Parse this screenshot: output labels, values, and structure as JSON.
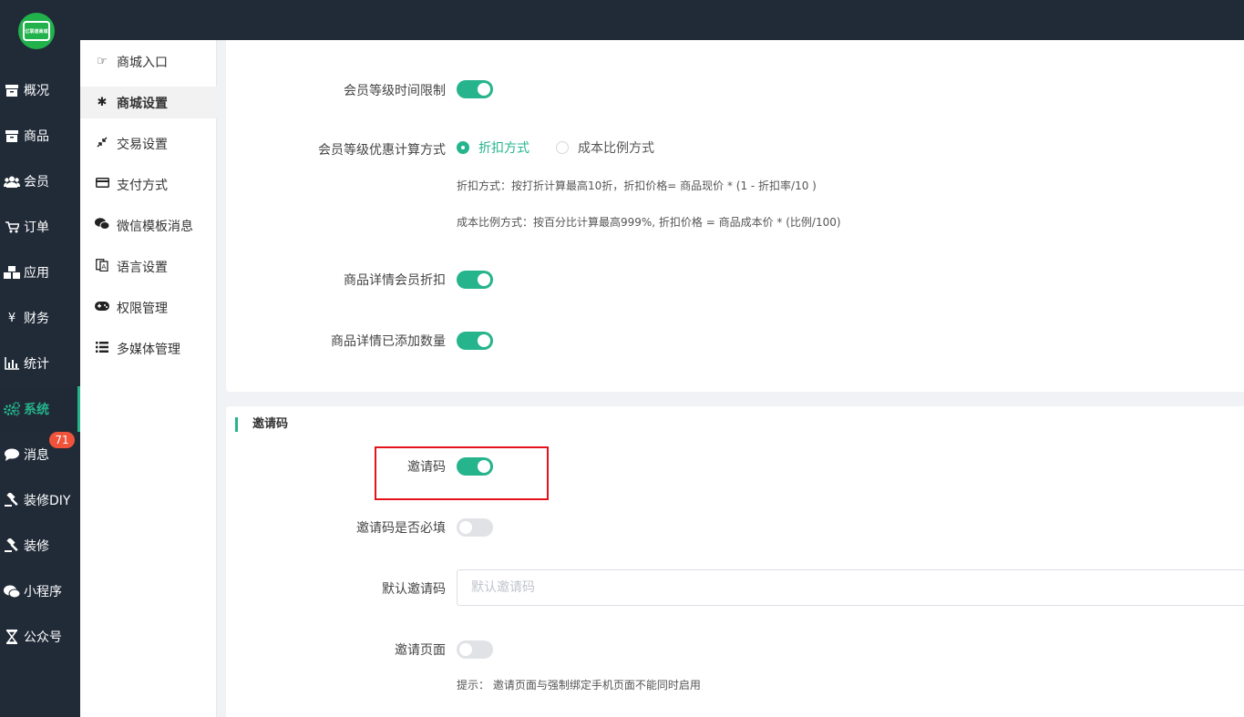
{
  "logo": {
    "text": "亿联道商城"
  },
  "nav": {
    "items": [
      {
        "label": "概况",
        "icon": "archive-icon"
      },
      {
        "label": "商品",
        "icon": "archive-icon"
      },
      {
        "label": "会员",
        "icon": "users-icon"
      },
      {
        "label": "订单",
        "icon": "cart-icon"
      },
      {
        "label": "应用",
        "icon": "cubes-icon"
      },
      {
        "label": "财务",
        "icon": "yen-icon"
      },
      {
        "label": "统计",
        "icon": "bar-chart-icon"
      },
      {
        "label": "系统",
        "icon": "gears-icon",
        "active": true
      },
      {
        "label": "消息",
        "icon": "comment-icon",
        "badge": "71"
      },
      {
        "label": "装修DIY",
        "icon": "gavel-icon"
      },
      {
        "label": "装修",
        "icon": "gavel-icon"
      },
      {
        "label": "小程序",
        "icon": "wechat-icon"
      },
      {
        "label": "公众号",
        "icon": "hourglass-icon"
      }
    ]
  },
  "submenu": {
    "items": [
      {
        "label": "商城入口",
        "icon": "hand-pointer-icon"
      },
      {
        "label": "商城设置",
        "icon": "cog-icon",
        "active": true
      },
      {
        "label": "交易设置",
        "icon": "compress-icon"
      },
      {
        "label": "支付方式",
        "icon": "credit-card-icon"
      },
      {
        "label": "微信模板消息",
        "icon": "wechat-icon"
      },
      {
        "label": "语言设置",
        "icon": "translate-icon"
      },
      {
        "label": "权限管理",
        "icon": "gamepad-icon"
      },
      {
        "label": "多媒体管理",
        "icon": "list-icon"
      }
    ]
  },
  "member": {
    "level_time_limit": {
      "label": "会员等级时间限制",
      "on": true
    },
    "discount_calc": {
      "label": "会员等级优惠计算方式",
      "options": [
        "折扣方式",
        "成本比例方式"
      ],
      "selected": "折扣方式",
      "hint1": "折扣方式：按打折计算最高10折，折扣价格= 商品现价 * (1 - 折扣率/10 )",
      "hint2": "成本比例方式：按百分比计算最高999%, 折扣价格 = 商品成本价 * (比例/100)"
    },
    "detail_discount": {
      "label": "商品详情会员折扣",
      "on": true
    },
    "detail_added_qty": {
      "label": "商品详情已添加数量",
      "on": true
    }
  },
  "invite": {
    "section_title": "邀请码",
    "code": {
      "label": "邀请码",
      "on": true
    },
    "required": {
      "label": "邀请码是否必填",
      "on": false
    },
    "default_code": {
      "label": "默认邀请码",
      "value": "",
      "placeholder": "默认邀请码"
    },
    "page": {
      "label": "邀请页面",
      "on": false
    },
    "tip": "提示：  邀请页面与强制绑定手机页面不能同时启用"
  },
  "colors": {
    "accent": "#26b48c",
    "nav_bg": "#212b38",
    "badge": "#f0533a",
    "highlight_box": "#e4131b"
  }
}
